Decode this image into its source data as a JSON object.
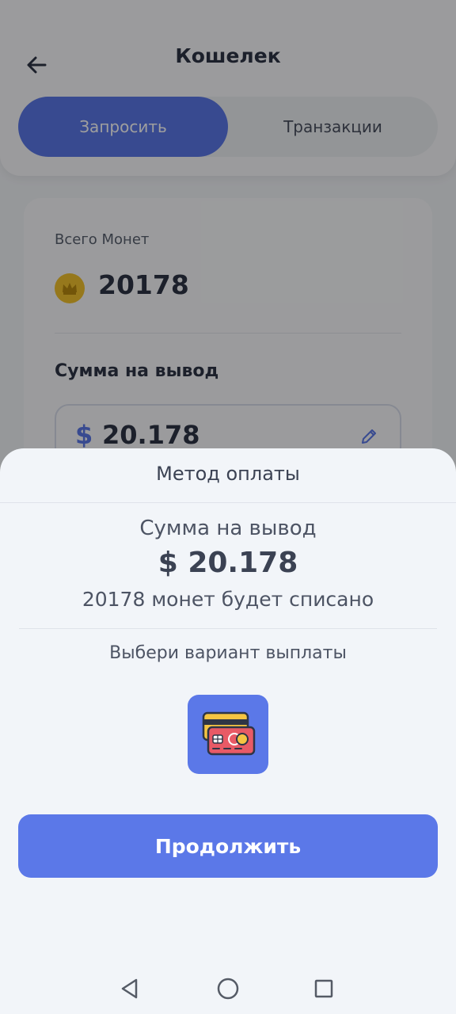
{
  "header": {
    "title": "Кошелек",
    "tabs": [
      {
        "label": "Запросить",
        "active": true
      },
      {
        "label": "Транзакции",
        "active": false
      }
    ]
  },
  "card": {
    "total_label": "Всего Монет",
    "total_value": "20178",
    "withdraw_label": "Сумма на вывод",
    "amount_currency": "$",
    "amount_value": "20.178"
  },
  "sheet": {
    "title": "Метод оплаты",
    "sum_label": "Сумма на вывод",
    "sum_value": "$ 20.178",
    "note": "20178 монет будет списано",
    "choose_label": "Выбери вариант выплаты",
    "method_icon": "credit-cards-icon",
    "continue_label": "Продолжить"
  },
  "colors": {
    "accent": "#5b78e8",
    "coin": "#f2c22e"
  },
  "icons": {
    "back": "arrow-left-icon",
    "coin": "crown-coin-icon",
    "edit": "pencil-icon",
    "nav_back": "triangle-back-icon",
    "nav_home": "circle-home-icon",
    "nav_recent": "square-recent-icon"
  }
}
